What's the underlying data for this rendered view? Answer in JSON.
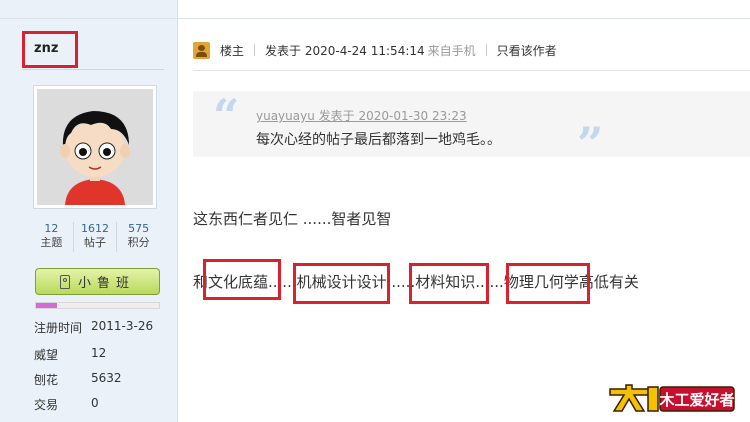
{
  "user": {
    "name": "znz",
    "stats": [
      {
        "value": "12",
        "label": "主题"
      },
      {
        "value": "1612",
        "label": "帖子"
      },
      {
        "value": "575",
        "label": "积分"
      }
    ],
    "rank": "小鲁班",
    "rank_progress": 0.17,
    "info": [
      {
        "key": "注册时间",
        "value": "2011-3-26"
      },
      {
        "key": "威望",
        "value": "12"
      },
      {
        "key": "刨花",
        "value": "5632"
      },
      {
        "key": "交易",
        "value": "0"
      }
    ]
  },
  "post": {
    "floor": "楼主",
    "posted_at": "发表于 2020-4-24 11:54:14",
    "source": "来自手机",
    "only_author": "只看该作者",
    "quote": {
      "author_line": "yuayuayu 发表于 2020-01-30 23:23",
      "text": "每次心经的帖子最后都落到一地鸡毛。。"
    },
    "line1": "这东西仁者见仁 ......智者见智",
    "line2": "和文化底蕴......机械设计设计......材料知识......物理几何学高低有关"
  },
  "watermark": {
    "text": "木工爱好者"
  },
  "colors": {
    "sidebar_bg": "#eaf1f8",
    "highlight": "#d8232e",
    "rank_green": "#b9da5b",
    "progress": "#d46bd4",
    "link_blue": "#336699"
  }
}
